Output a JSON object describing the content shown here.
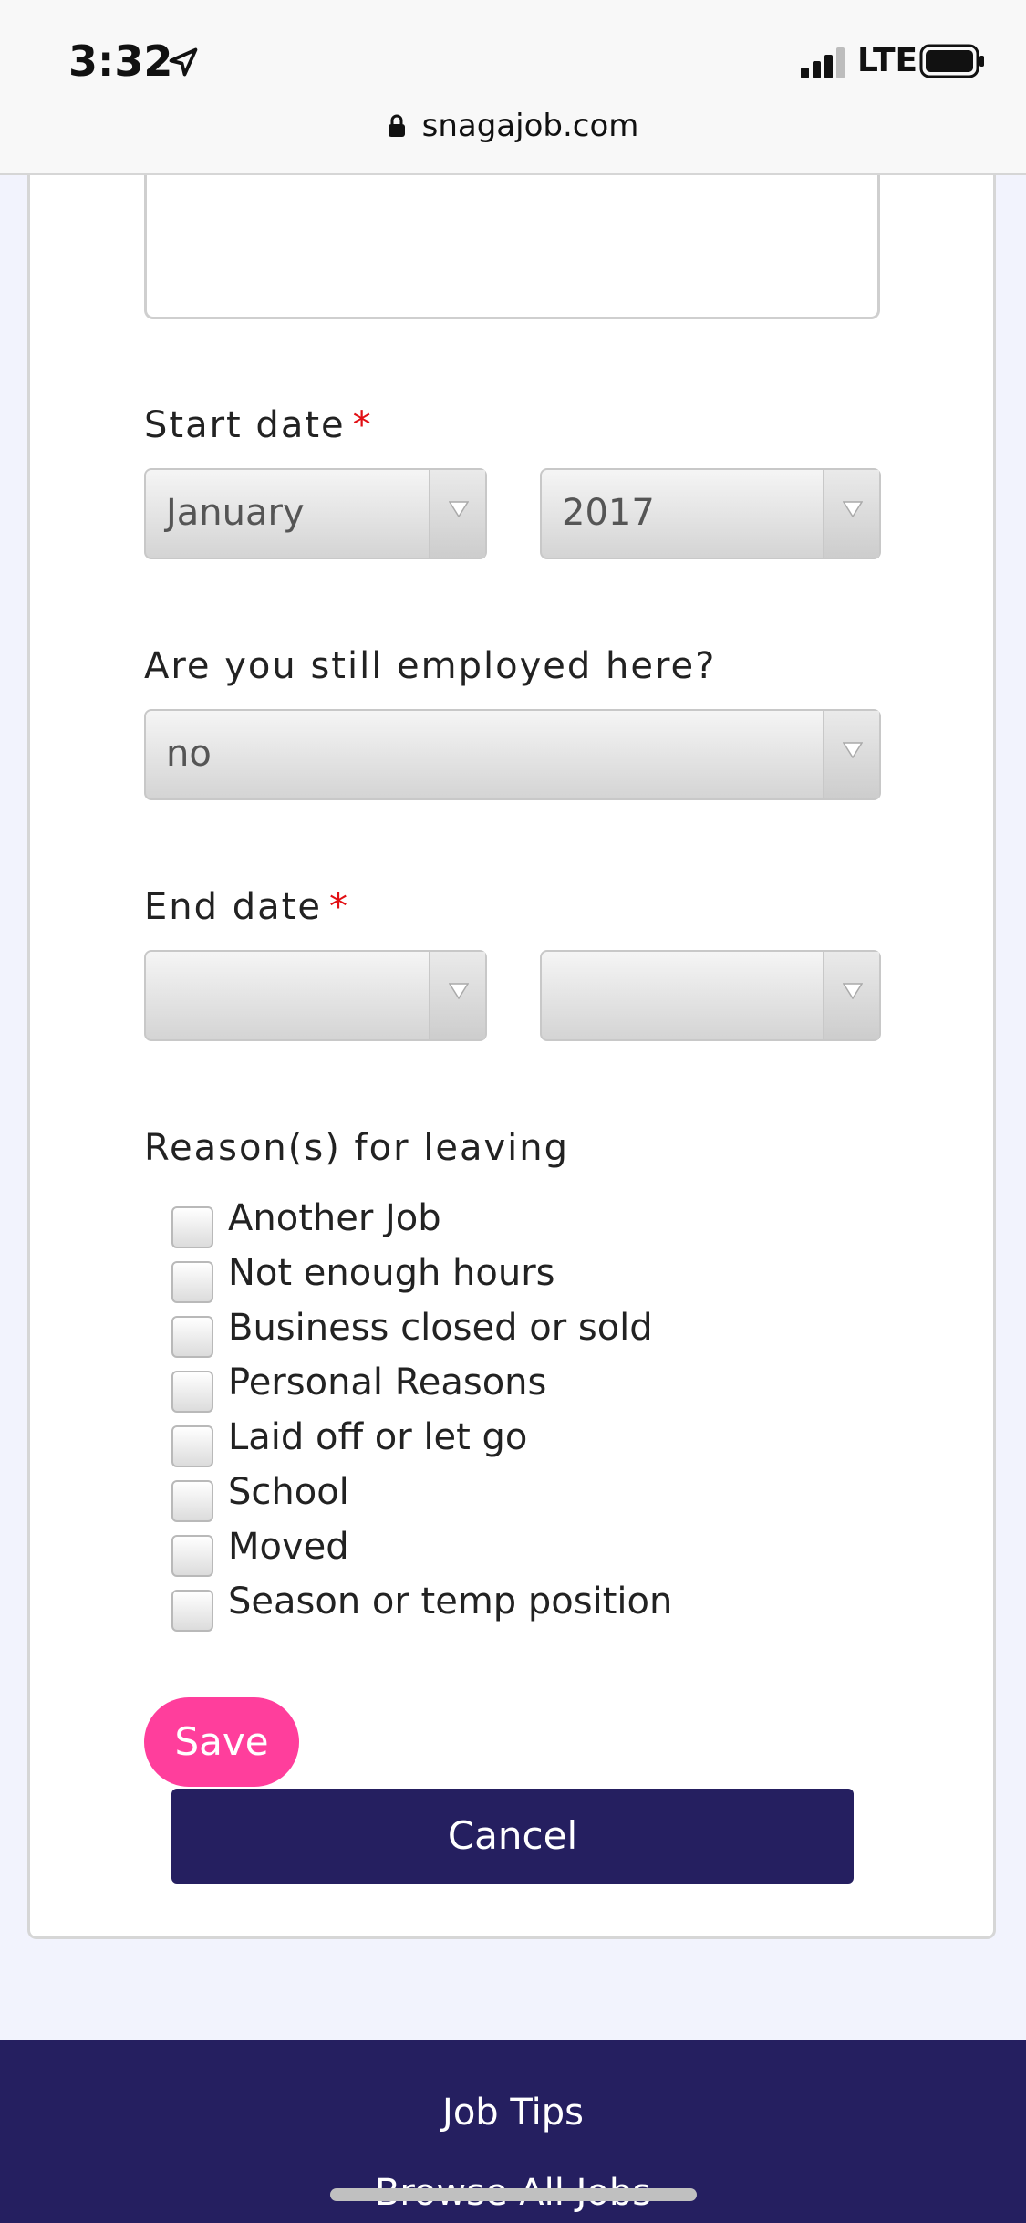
{
  "status_bar": {
    "time": "3:32",
    "network": "LTE"
  },
  "url_bar": {
    "domain": "snagajob.com"
  },
  "form": {
    "start_date": {
      "label": "Start date",
      "required_mark": "*",
      "month": "January",
      "year": "2017"
    },
    "still_employed": {
      "label": "Are you still employed here?",
      "value": "no"
    },
    "end_date": {
      "label": "End date",
      "required_mark": "*",
      "month": "",
      "year": ""
    },
    "reasons": {
      "label": "Reason(s) for leaving",
      "options": [
        "Another Job",
        "Not enough hours",
        "Business closed or sold",
        "Personal Reasons",
        "Laid off or let go",
        "School",
        "Moved",
        "Season or temp position"
      ]
    },
    "save_label": "Save",
    "cancel_label": "Cancel"
  },
  "footer": {
    "links": [
      "Job Tips",
      "Browse All Jobs"
    ]
  },
  "colors": {
    "save_button": "#ff3e9c",
    "cancel_button": "#251f60",
    "footer_background": "#251f60",
    "required_mark": "#e20f14"
  }
}
